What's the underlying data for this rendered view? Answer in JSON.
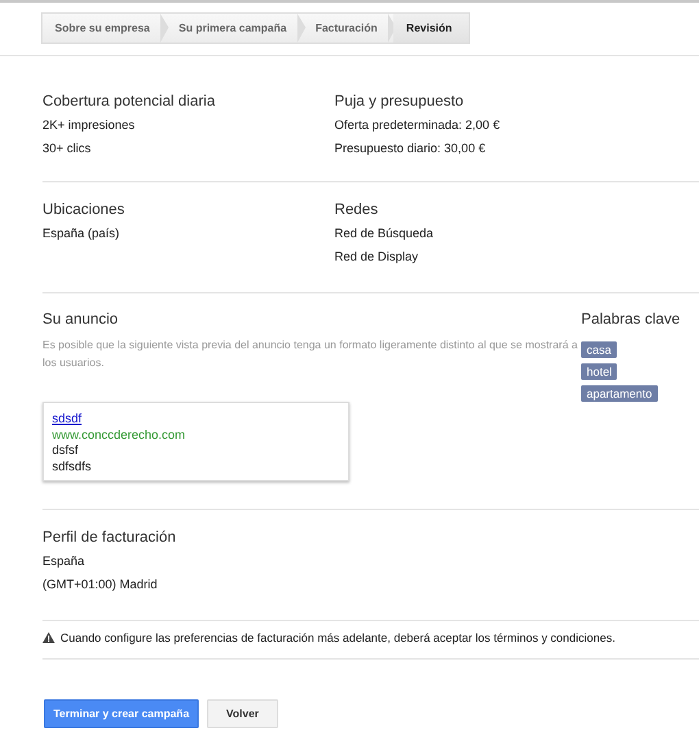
{
  "steps": [
    {
      "label": "Sobre su empresa",
      "selected": false
    },
    {
      "label": "Su primera campaña",
      "selected": false
    },
    {
      "label": "Facturación",
      "selected": false
    },
    {
      "label": "Revisión",
      "selected": true
    }
  ],
  "sections": [
    {
      "columns": [
        {
          "title": "Cobertura potencial diaria",
          "lines": [
            "2K+ impresiones",
            "30+ clics"
          ]
        },
        {
          "title": "Puja y presupuesto",
          "lines": [
            "Oferta predeterminada: 2,00 €",
            "Presupuesto diario: 30,00 €"
          ]
        }
      ]
    },
    {
      "columns": [
        {
          "title": "Ubicaciones",
          "lines": [
            "España (país)"
          ]
        },
        {
          "title": "Redes",
          "lines": [
            "Red de Búsqueda",
            "Red de Display"
          ]
        }
      ]
    }
  ],
  "ad": {
    "title": "Su anuncio",
    "note": "Es posible que la siguiente vista previa del anuncio tenga un formato ligeramente distinto al que se mostrará a los usuarios.",
    "headline": "sdsdf",
    "url": "www.conccderecho.com",
    "lines": [
      "dsfsf",
      "sdfsdfs"
    ]
  },
  "keywords": {
    "title": "Palabras clave",
    "items": [
      "casa",
      "hotel",
      "apartamento"
    ]
  },
  "billing": {
    "title": "Perfil de facturación",
    "lines": [
      "España",
      "(GMT+01:00) Madrid"
    ]
  },
  "warning": "Cuando configure las preferencias de facturación más adelante, deberá aceptar los términos y condiciones.",
  "buttons": [
    {
      "label": "Terminar y crear campaña",
      "kind": "primary"
    },
    {
      "label": "Volver",
      "kind": "secondary"
    }
  ]
}
